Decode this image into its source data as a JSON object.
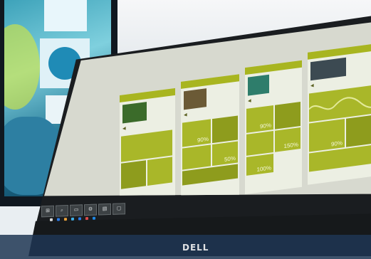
{
  "scene": {
    "description_free": true,
    "brand_logo_text": "DELL",
    "colors": {
      "screen_accent": "#a9b729",
      "screen_accent_dark": "#8e9c1d",
      "panel_bg": "#ecefe3",
      "monitor_bezel": "#1a1d20",
      "background_monitor": "#3aa0b8"
    }
  },
  "panels": [
    {
      "title": "",
      "tiles": [
        {
          "num": ""
        },
        {
          "num": ""
        }
      ]
    },
    {
      "title": "",
      "tiles": [
        {
          "num": "90%"
        },
        {
          "num": "50%"
        }
      ]
    },
    {
      "title": "",
      "tiles": [
        {
          "num": "90%"
        },
        {
          "num": "150%"
        },
        {
          "num": "100%"
        }
      ]
    },
    {
      "title": "",
      "tiles": [
        {
          "num": "90%"
        }
      ]
    }
  ],
  "taskbar": {
    "icons": [
      "start-icon",
      "search-icon",
      "task-view-icon",
      "settings-icon",
      "file-icon",
      "window-icon"
    ]
  }
}
